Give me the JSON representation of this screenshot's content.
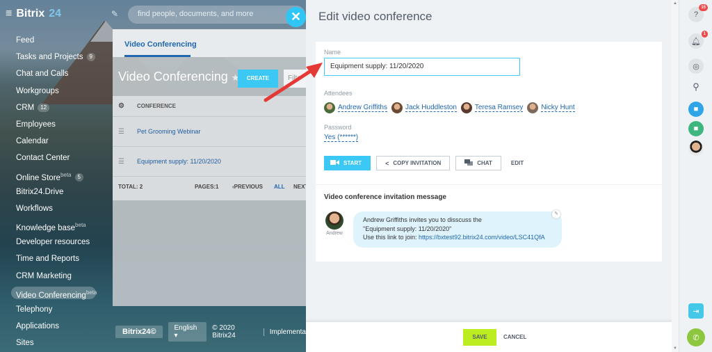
{
  "app": {
    "logo_text": "Bitrix",
    "logo_suffix": "24",
    "search_placeholder": "find people, documents, and more"
  },
  "sidebar": {
    "items": [
      {
        "label": "Feed",
        "count": ""
      },
      {
        "label": "Tasks and Projects",
        "count": "9"
      },
      {
        "label": "Chat and Calls",
        "count": ""
      },
      {
        "label": "Workgroups",
        "count": ""
      },
      {
        "label": "CRM",
        "count": "12"
      },
      {
        "label": "Employees",
        "count": ""
      },
      {
        "label": "Calendar",
        "count": ""
      },
      {
        "label": "Contact Center",
        "count": ""
      },
      {
        "label": "Online Store",
        "count": "5",
        "sup": "beta"
      },
      {
        "label": "Bitrix24.Drive",
        "count": ""
      },
      {
        "label": "Workflows",
        "count": ""
      },
      {
        "label": "Knowledge base",
        "count": "",
        "sup": "beta"
      },
      {
        "label": "Developer resources",
        "count": ""
      },
      {
        "label": "Time and Reports",
        "count": ""
      },
      {
        "label": "CRM Marketing",
        "count": ""
      },
      {
        "label": "Video Conferencing",
        "count": "",
        "sup": "beta",
        "active": true
      },
      {
        "label": "Telephony",
        "count": ""
      },
      {
        "label": "Applications",
        "count": ""
      },
      {
        "label": "Sites",
        "count": ""
      }
    ]
  },
  "vc_page": {
    "tab": "Video Conferencing",
    "title": "Video Conferencing",
    "create_label": "CREATE",
    "filter_placeholder": "Filte",
    "column_header": "CONFERENCE",
    "rows": [
      "Pet Grooming Webinar",
      "Equipment supply: 11/20/2020"
    ],
    "total": "TOTAL: 2",
    "pages": "PAGES:",
    "page_num": "1",
    "previous": "PREVIOUS",
    "all": "ALL",
    "next": "NEXT"
  },
  "footer": {
    "brand": "Bitrix24©",
    "language": "English",
    "copyright": "© 2020 Bitrix24",
    "implementation": "Implementa"
  },
  "slider": {
    "title": "Edit video conference",
    "name_label": "Name",
    "name_value": "Equipment supply: 11/20/2020",
    "attendees_label": "Attendees",
    "attendees": [
      {
        "name": "Andrew Griffiths",
        "color": "#4a6b3a"
      },
      {
        "name": "Jack Huddleston",
        "color": "#6b4a35"
      },
      {
        "name": "Teresa Ramsey",
        "color": "#5a3a2e"
      },
      {
        "name": "Nicky Hunt",
        "color": "#7d6a5a"
      }
    ],
    "password_label": "Password",
    "password_value": "Yes (******)",
    "start_label": "START",
    "copy_label": "COPY INVITATION",
    "chat_label": "CHAT",
    "edit_label": "EDIT",
    "invitation_title": "Video conference invitation message",
    "avatar_name": "Andrew",
    "bubble_line1": "Andrew Griffiths invites you to disscuss the",
    "bubble_line2": "\"Equipment supply: 11/20/2020\"",
    "bubble_line3_prefix": "Use this link to join: ",
    "bubble_link": "https://bxtest92.bitrix24.com/video/LSC41QfA",
    "save_label": "SAVE",
    "cancel_label": "CANCEL"
  },
  "rail": {
    "help_badge": "15",
    "notify_badge": "1"
  },
  "colors": {
    "accent": "#3bc8f5",
    "link": "#2067b0",
    "save": "#bbed21"
  }
}
